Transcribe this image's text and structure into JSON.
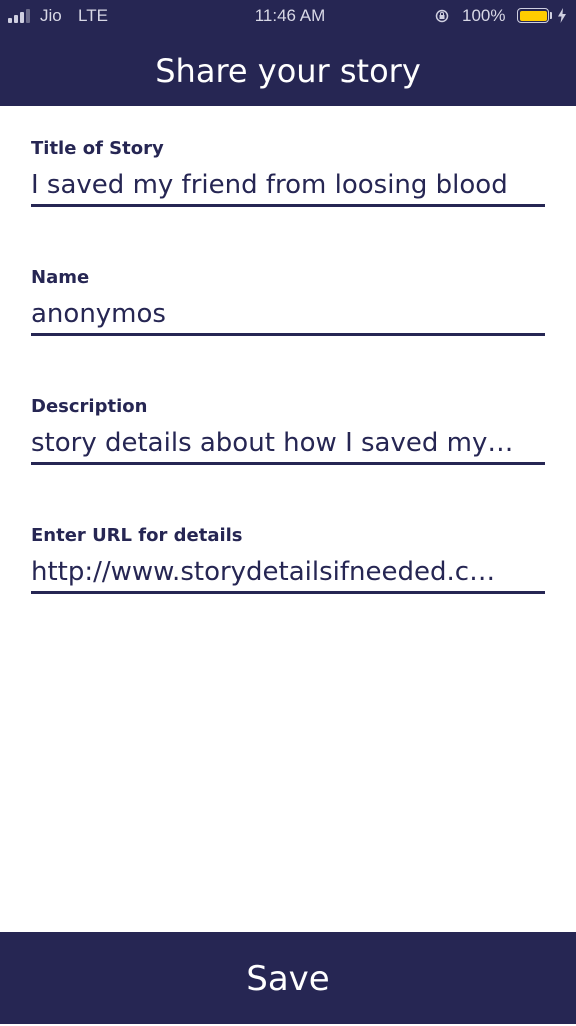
{
  "status_bar": {
    "carrier": "Jio",
    "network": "LTE",
    "time": "11:46 AM",
    "battery_percent": "100%",
    "battery_level": 1.0,
    "battery_color": "#ffcc00",
    "icons": [
      "signal-icon",
      "orientation-lock-icon",
      "battery-icon",
      "charging-bolt-icon"
    ]
  },
  "header": {
    "title": "Share your story",
    "background": "#262653"
  },
  "form": {
    "fields": [
      {
        "label": "Title of Story",
        "value": "I saved my friend from loosing blood"
      },
      {
        "label": "Name",
        "value": "anonymos"
      },
      {
        "label": "Description",
        "value": "story details about how I saved my…"
      },
      {
        "label": "Enter URL for details",
        "value": "http://www.storydetailsifneeded.c…"
      }
    ]
  },
  "footer": {
    "save_label": "Save"
  }
}
